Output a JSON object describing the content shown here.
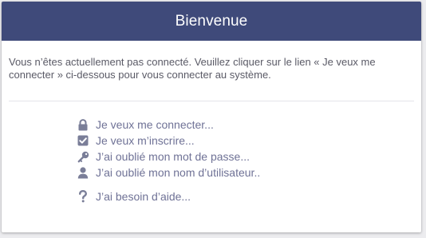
{
  "header": {
    "title": "Bienvenue",
    "background_color": "#3f4a7a"
  },
  "intro": {
    "text": "Vous n’êtes actuellement pas connecté. Veuillez cliquer sur le lien « Je veux me connecter » ci-dessous pour vous connecter au système."
  },
  "links": [
    {
      "label": "Je veux me connecter...",
      "icon": "lock-icon"
    },
    {
      "label": "Je veux m’inscrire...",
      "icon": "checkbox-icon"
    },
    {
      "label": "J’ai oublié mon mot de passe...",
      "icon": "key-icon"
    },
    {
      "label": "J’ai oublié mon nom d’utilisateur..",
      "icon": "user-icon"
    }
  ],
  "help": {
    "label": "J’ai besoin d’aide...",
    "icon": "question-icon"
  },
  "colors": {
    "link_text": "#6f7296",
    "icon": "#7a7e98",
    "intro_text": "#5a5a66"
  }
}
